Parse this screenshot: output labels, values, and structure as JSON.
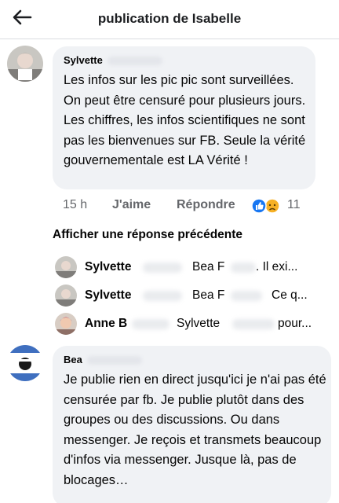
{
  "header": {
    "title": "publication de Isabelle",
    "back_icon": "back-arrow-icon"
  },
  "comments": [
    {
      "author": "Sylvette",
      "text": "Les infos sur les pic pic sont surveillées. On peut être censuré pour plusieurs jours. Les chiffres, les infos scientifiques ne sont pas les bienvenues sur FB. Seule la vérité gouvernementale est LA Vérité !",
      "time": "15 h",
      "like_label": "J'aime",
      "reply_label": "Répondre",
      "reactions": [
        "like",
        "sad"
      ],
      "reaction_count": "11"
    },
    {
      "author": "Bea",
      "text": "Je publie rien en direct jusqu'ici je n'ai pas été censurée par fb. Je publie plutôt dans des groupes ou des discussions. Ou dans messenger. Je reçois et transmets beaucoup d'infos via messenger. Jusque là, pas de blocages…"
    }
  ],
  "previous_replies_label": "Afficher une réponse précédente",
  "replies": [
    {
      "name": "Sylvette",
      "target": "Bea F",
      "snippet": ". Il exi..."
    },
    {
      "name": "Sylvette",
      "target": "Bea F",
      "snippet": "Ce q..."
    },
    {
      "name": "Anne B",
      "target": "Sylvette",
      "snippet": "pour..."
    }
  ],
  "colors": {
    "bubble": "#f0f2f5",
    "like_blue": "#1877f2",
    "sad_yellow": "#f7b125",
    "meta_gray": "#65676b"
  }
}
